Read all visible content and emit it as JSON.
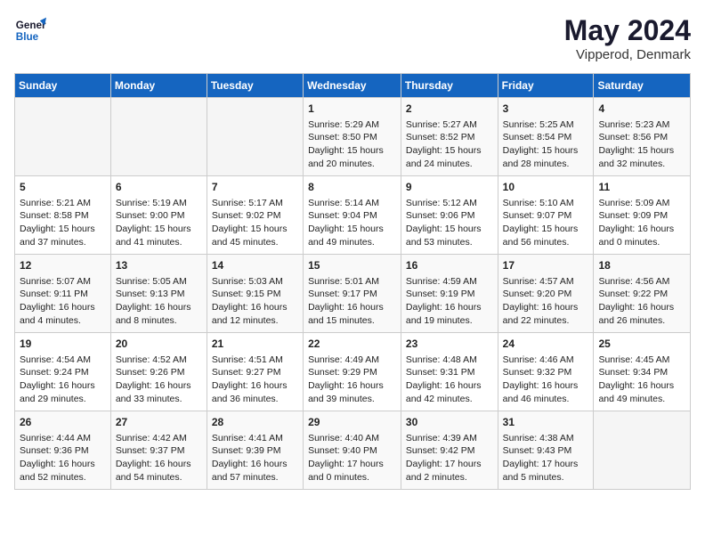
{
  "header": {
    "logo_line1": "General",
    "logo_line2": "Blue",
    "month_year": "May 2024",
    "location": "Vipperod, Denmark"
  },
  "weekdays": [
    "Sunday",
    "Monday",
    "Tuesday",
    "Wednesday",
    "Thursday",
    "Friday",
    "Saturday"
  ],
  "weeks": [
    [
      {
        "day": "",
        "info": ""
      },
      {
        "day": "",
        "info": ""
      },
      {
        "day": "",
        "info": ""
      },
      {
        "day": "1",
        "info": "Sunrise: 5:29 AM\nSunset: 8:50 PM\nDaylight: 15 hours\nand 20 minutes."
      },
      {
        "day": "2",
        "info": "Sunrise: 5:27 AM\nSunset: 8:52 PM\nDaylight: 15 hours\nand 24 minutes."
      },
      {
        "day": "3",
        "info": "Sunrise: 5:25 AM\nSunset: 8:54 PM\nDaylight: 15 hours\nand 28 minutes."
      },
      {
        "day": "4",
        "info": "Sunrise: 5:23 AM\nSunset: 8:56 PM\nDaylight: 15 hours\nand 32 minutes."
      }
    ],
    [
      {
        "day": "5",
        "info": "Sunrise: 5:21 AM\nSunset: 8:58 PM\nDaylight: 15 hours\nand 37 minutes."
      },
      {
        "day": "6",
        "info": "Sunrise: 5:19 AM\nSunset: 9:00 PM\nDaylight: 15 hours\nand 41 minutes."
      },
      {
        "day": "7",
        "info": "Sunrise: 5:17 AM\nSunset: 9:02 PM\nDaylight: 15 hours\nand 45 minutes."
      },
      {
        "day": "8",
        "info": "Sunrise: 5:14 AM\nSunset: 9:04 PM\nDaylight: 15 hours\nand 49 minutes."
      },
      {
        "day": "9",
        "info": "Sunrise: 5:12 AM\nSunset: 9:06 PM\nDaylight: 15 hours\nand 53 minutes."
      },
      {
        "day": "10",
        "info": "Sunrise: 5:10 AM\nSunset: 9:07 PM\nDaylight: 15 hours\nand 56 minutes."
      },
      {
        "day": "11",
        "info": "Sunrise: 5:09 AM\nSunset: 9:09 PM\nDaylight: 16 hours\nand 0 minutes."
      }
    ],
    [
      {
        "day": "12",
        "info": "Sunrise: 5:07 AM\nSunset: 9:11 PM\nDaylight: 16 hours\nand 4 minutes."
      },
      {
        "day": "13",
        "info": "Sunrise: 5:05 AM\nSunset: 9:13 PM\nDaylight: 16 hours\nand 8 minutes."
      },
      {
        "day": "14",
        "info": "Sunrise: 5:03 AM\nSunset: 9:15 PM\nDaylight: 16 hours\nand 12 minutes."
      },
      {
        "day": "15",
        "info": "Sunrise: 5:01 AM\nSunset: 9:17 PM\nDaylight: 16 hours\nand 15 minutes."
      },
      {
        "day": "16",
        "info": "Sunrise: 4:59 AM\nSunset: 9:19 PM\nDaylight: 16 hours\nand 19 minutes."
      },
      {
        "day": "17",
        "info": "Sunrise: 4:57 AM\nSunset: 9:20 PM\nDaylight: 16 hours\nand 22 minutes."
      },
      {
        "day": "18",
        "info": "Sunrise: 4:56 AM\nSunset: 9:22 PM\nDaylight: 16 hours\nand 26 minutes."
      }
    ],
    [
      {
        "day": "19",
        "info": "Sunrise: 4:54 AM\nSunset: 9:24 PM\nDaylight: 16 hours\nand 29 minutes."
      },
      {
        "day": "20",
        "info": "Sunrise: 4:52 AM\nSunset: 9:26 PM\nDaylight: 16 hours\nand 33 minutes."
      },
      {
        "day": "21",
        "info": "Sunrise: 4:51 AM\nSunset: 9:27 PM\nDaylight: 16 hours\nand 36 minutes."
      },
      {
        "day": "22",
        "info": "Sunrise: 4:49 AM\nSunset: 9:29 PM\nDaylight: 16 hours\nand 39 minutes."
      },
      {
        "day": "23",
        "info": "Sunrise: 4:48 AM\nSunset: 9:31 PM\nDaylight: 16 hours\nand 42 minutes."
      },
      {
        "day": "24",
        "info": "Sunrise: 4:46 AM\nSunset: 9:32 PM\nDaylight: 16 hours\nand 46 minutes."
      },
      {
        "day": "25",
        "info": "Sunrise: 4:45 AM\nSunset: 9:34 PM\nDaylight: 16 hours\nand 49 minutes."
      }
    ],
    [
      {
        "day": "26",
        "info": "Sunrise: 4:44 AM\nSunset: 9:36 PM\nDaylight: 16 hours\nand 52 minutes."
      },
      {
        "day": "27",
        "info": "Sunrise: 4:42 AM\nSunset: 9:37 PM\nDaylight: 16 hours\nand 54 minutes."
      },
      {
        "day": "28",
        "info": "Sunrise: 4:41 AM\nSunset: 9:39 PM\nDaylight: 16 hours\nand 57 minutes."
      },
      {
        "day": "29",
        "info": "Sunrise: 4:40 AM\nSunset: 9:40 PM\nDaylight: 17 hours\nand 0 minutes."
      },
      {
        "day": "30",
        "info": "Sunrise: 4:39 AM\nSunset: 9:42 PM\nDaylight: 17 hours\nand 2 minutes."
      },
      {
        "day": "31",
        "info": "Sunrise: 4:38 AM\nSunset: 9:43 PM\nDaylight: 17 hours\nand 5 minutes."
      },
      {
        "day": "",
        "info": ""
      }
    ]
  ]
}
